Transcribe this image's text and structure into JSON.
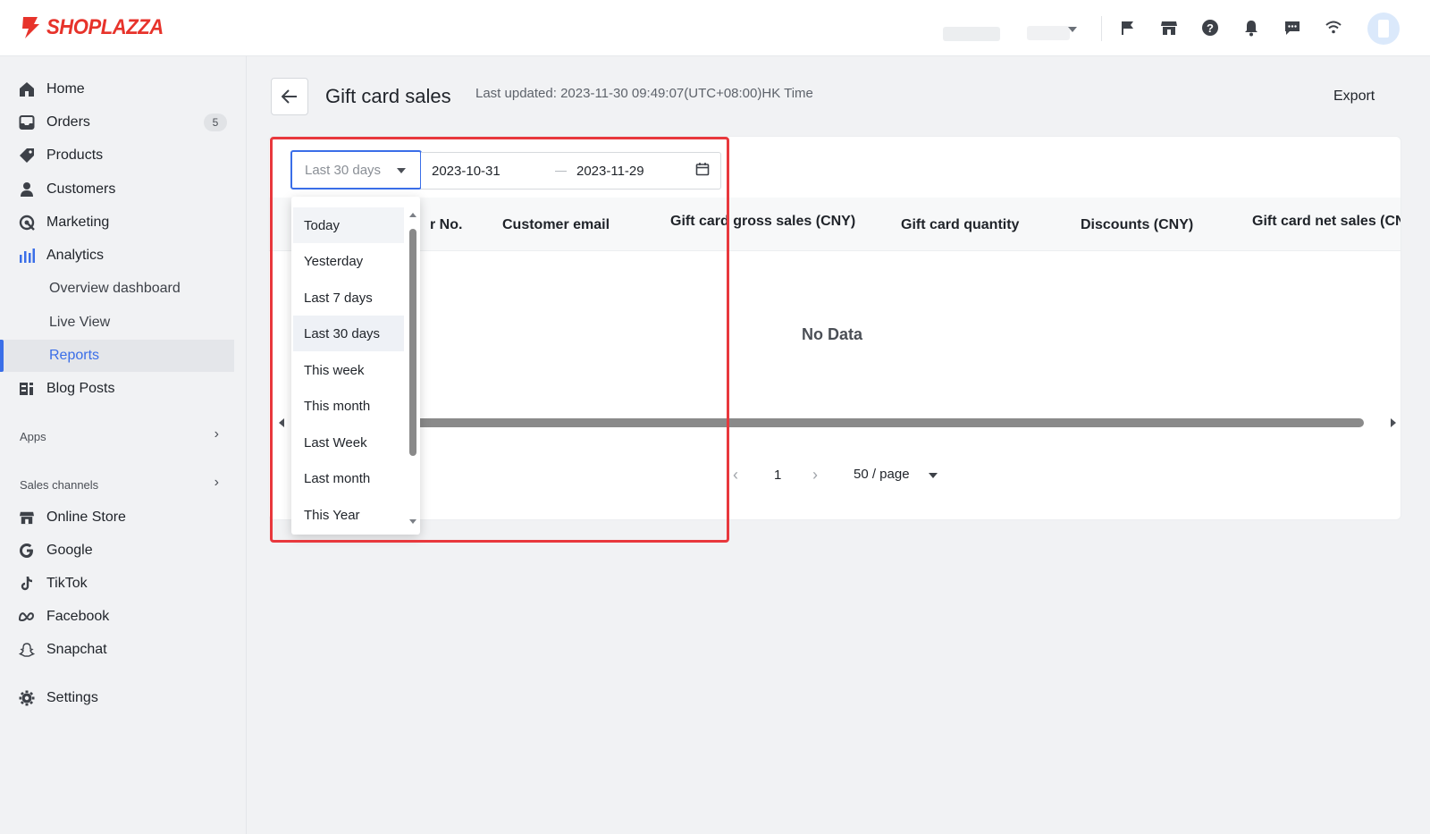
{
  "brand": {
    "name": "SHOPLAZZA",
    "color": "#e7332b"
  },
  "topbar": {
    "icons": [
      "flag-icon",
      "store-icon",
      "help-icon",
      "bell-icon",
      "chat-icon",
      "wifi-icon"
    ]
  },
  "sidebar": {
    "items": [
      {
        "label": "Home",
        "icon": "home-icon"
      },
      {
        "label": "Orders",
        "icon": "inbox-icon",
        "badge": "5"
      },
      {
        "label": "Products",
        "icon": "tag-icon"
      },
      {
        "label": "Customers",
        "icon": "person-icon"
      },
      {
        "label": "Marketing",
        "icon": "marketing-icon"
      },
      {
        "label": "Analytics",
        "icon": "bar-chart-icon"
      }
    ],
    "analytics_sub": [
      "Overview dashboard",
      "Live View",
      "Reports"
    ],
    "blog": "Blog Posts",
    "apps_label": "Apps",
    "sales_channels_label": "Sales channels",
    "channels": [
      "Online Store",
      "Google",
      "TikTok",
      "Facebook",
      "Snapchat"
    ],
    "settings": "Settings"
  },
  "header": {
    "title": "Gift card sales",
    "last_updated": "Last updated: 2023-11-30 09:49:07(UTC+08:00)HK Time",
    "export": "Export"
  },
  "filter": {
    "range_selected": "Last 30 days",
    "date_start": "2023-10-31",
    "date_end": "2023-11-29"
  },
  "table": {
    "columns": [
      "r No.",
      "Customer email",
      "Gift card gross sales (CNY)",
      "Gift card quantity",
      "Discounts (CNY)",
      "Gift card net sales (CNY"
    ],
    "empty_text": "No Data"
  },
  "pagination": {
    "page": "1",
    "page_size": "50 / page"
  },
  "dropdown": {
    "options": [
      "Today",
      "Yesterday",
      "Last 7 days",
      "Last 30 days",
      "This week",
      "This month",
      "Last Week",
      "Last month",
      "This Year"
    ],
    "selected_index": 3,
    "hover_index": 0
  },
  "colors": {
    "accent": "#3a6ee8",
    "highlight": "#e8383d"
  }
}
